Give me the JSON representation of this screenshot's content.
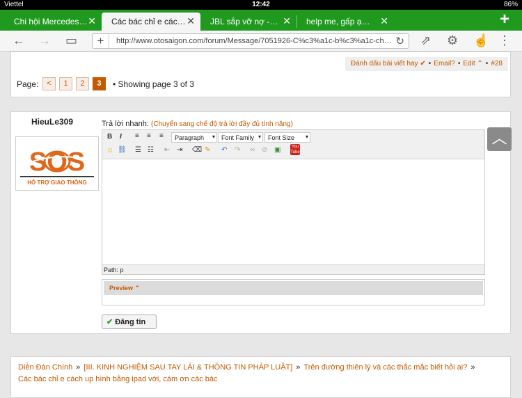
{
  "status": {
    "carrier": "Viettel",
    "time": "12:42",
    "battery": "86%"
  },
  "tabs": [
    {
      "label": "Chi hội Mercedes…",
      "active": false
    },
    {
      "label": "Các bác chỉ e các…",
      "active": true
    },
    {
      "label": "JBL sắp vỡ nợ -…",
      "active": false
    },
    {
      "label": "help me, gấp ạ…",
      "active": false
    }
  ],
  "url": "http://www.otosaigon.com/forum/Message/7051926-C%c3%a1c-b%c3%a1c-ch…",
  "post_actions": {
    "mark": "Đánh dấu bài viết hay",
    "email": "Email?",
    "edit": "Edit",
    "post_no": "#28"
  },
  "pager": {
    "label": "Page:",
    "prev": "<",
    "pages": [
      "1",
      "2",
      "3"
    ],
    "current": "3",
    "showing": "Showing page 3 of 3"
  },
  "user": {
    "name": "HieuLe309",
    "avatar_text": "SOS",
    "avatar_caption": "HỖ TRỢ GIAO THÔNG"
  },
  "reply": {
    "label": "Trả lời nhanh:",
    "switch_link": "(Chuyển sang chế độ trả lời đầy đủ tính năng)"
  },
  "editor": {
    "format": "Paragraph",
    "font_family": "Font Family",
    "font_size": "Font Size",
    "path": "Path: p",
    "bold": "B",
    "italic": "I"
  },
  "preview_label": "Preview",
  "submit_label": "Đăng tin",
  "breadcrumb": [
    "Diễn Đàn Chính",
    "[III. KINH NGHIỆM SAU TAY LÁI & THÔNG TIN PHÁP LUẬT]",
    "Trên đường thiên lý và các thắc mắc biết hỏi ai?",
    "Các bác chỉ e cách up hình bằng ipad với, cám ơn các bác"
  ],
  "colors": {
    "tab_bar": "#1f9a1f",
    "accent": "#c35a00"
  }
}
